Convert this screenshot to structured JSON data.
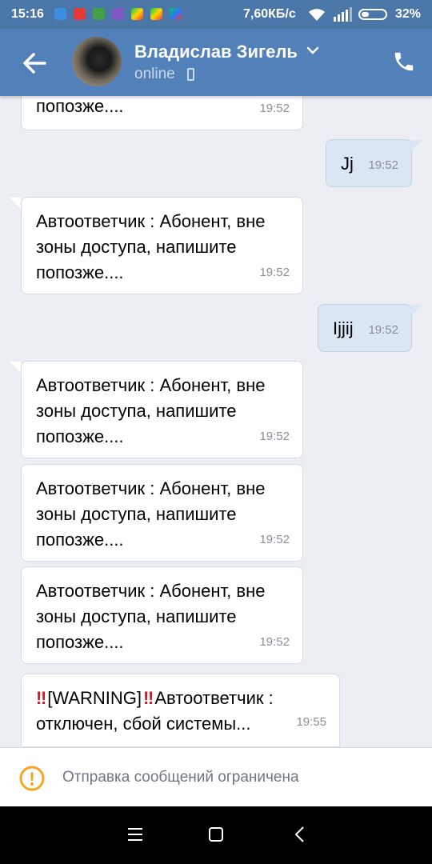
{
  "status_bar": {
    "time": "15:16",
    "speed": "7,60КБ/с",
    "battery_percent": "32%",
    "battery_level": 0.32
  },
  "header": {
    "contact_name": "Владислав Зигель",
    "status": "online"
  },
  "messages": [
    {
      "direction": "in",
      "text": "попозже....",
      "time": "19:52"
    },
    {
      "direction": "out",
      "text": "Jj",
      "time": "19:52"
    },
    {
      "direction": "in",
      "text": "Автоответчик : Абонент, вне\nзоны доступа, напишите\nпопозже....",
      "time": "19:52"
    },
    {
      "direction": "out",
      "text": "Ijjij",
      "time": "19:52"
    },
    {
      "direction": "in",
      "text": "Автоответчик : Абонент, вне\nзоны доступа, напишите\nпопозже....",
      "time": "19:52"
    },
    {
      "direction": "in",
      "text": "Автоответчик : Абонент, вне\nзоны доступа, напишите\nпопозже....",
      "time": "19:52"
    },
    {
      "direction": "in",
      "text": "Автоответчик : Абонент, вне\nзоны доступа, напишите\nпопозже....",
      "time": "19:52"
    },
    {
      "direction": "in",
      "warning_tag": "[WARNING]",
      "warning_mark": "‼",
      "text_after": "Автоответчик  :",
      "text_line2": "отключен, сбой системы...",
      "time": "19:55"
    }
  ],
  "restriction_notice": "Отправка сообщений ограничена",
  "colors": {
    "header": "#5181b8",
    "status_bar": "#4a76a8",
    "outgoing_bubble": "#dbe6f3",
    "incoming_bubble": "#ffffff",
    "warning_icon": "#f5a623",
    "warning_mark": "#d0191d"
  },
  "icons": [
    "back-arrow-icon",
    "chevron-down-icon",
    "mobile-phone-icon",
    "call-icon",
    "warning-icon",
    "menu-icon",
    "home-icon",
    "nav-back-icon"
  ]
}
